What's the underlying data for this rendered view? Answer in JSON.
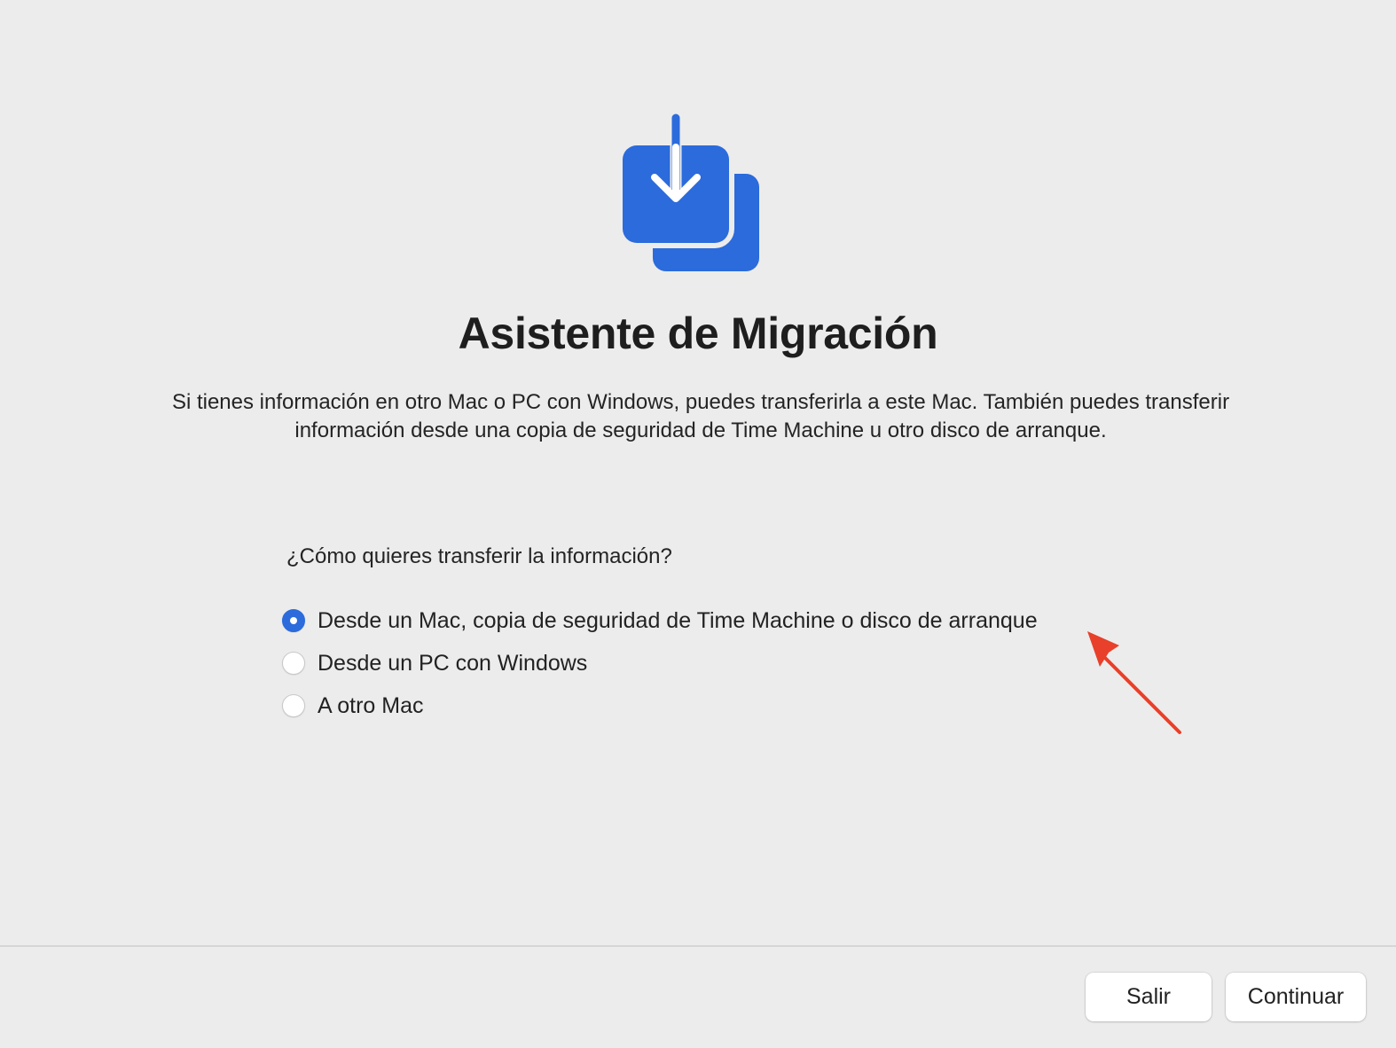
{
  "app": {
    "icon": "migration-assistant-icon",
    "title": "Asistente de Migración",
    "description": "Si tienes información en otro Mac o PC con Windows, puedes transferirla a este Mac. También puedes transferir información desde una copia de seguridad de Time Machine u otro disco de arranque.",
    "accent_color": "#2b6bdc"
  },
  "transfer": {
    "question": "¿Cómo quieres transferir la información?",
    "options": [
      {
        "label": "Desde un Mac, copia de seguridad de Time Machine o disco de arranque",
        "selected": true
      },
      {
        "label": "Desde un PC con Windows",
        "selected": false
      },
      {
        "label": "A otro Mac",
        "selected": false
      }
    ]
  },
  "annotation": {
    "icon": "red-arrow-pointer",
    "color": "#e8402a"
  },
  "footer": {
    "quit_label": "Salir",
    "continue_label": "Continuar"
  }
}
